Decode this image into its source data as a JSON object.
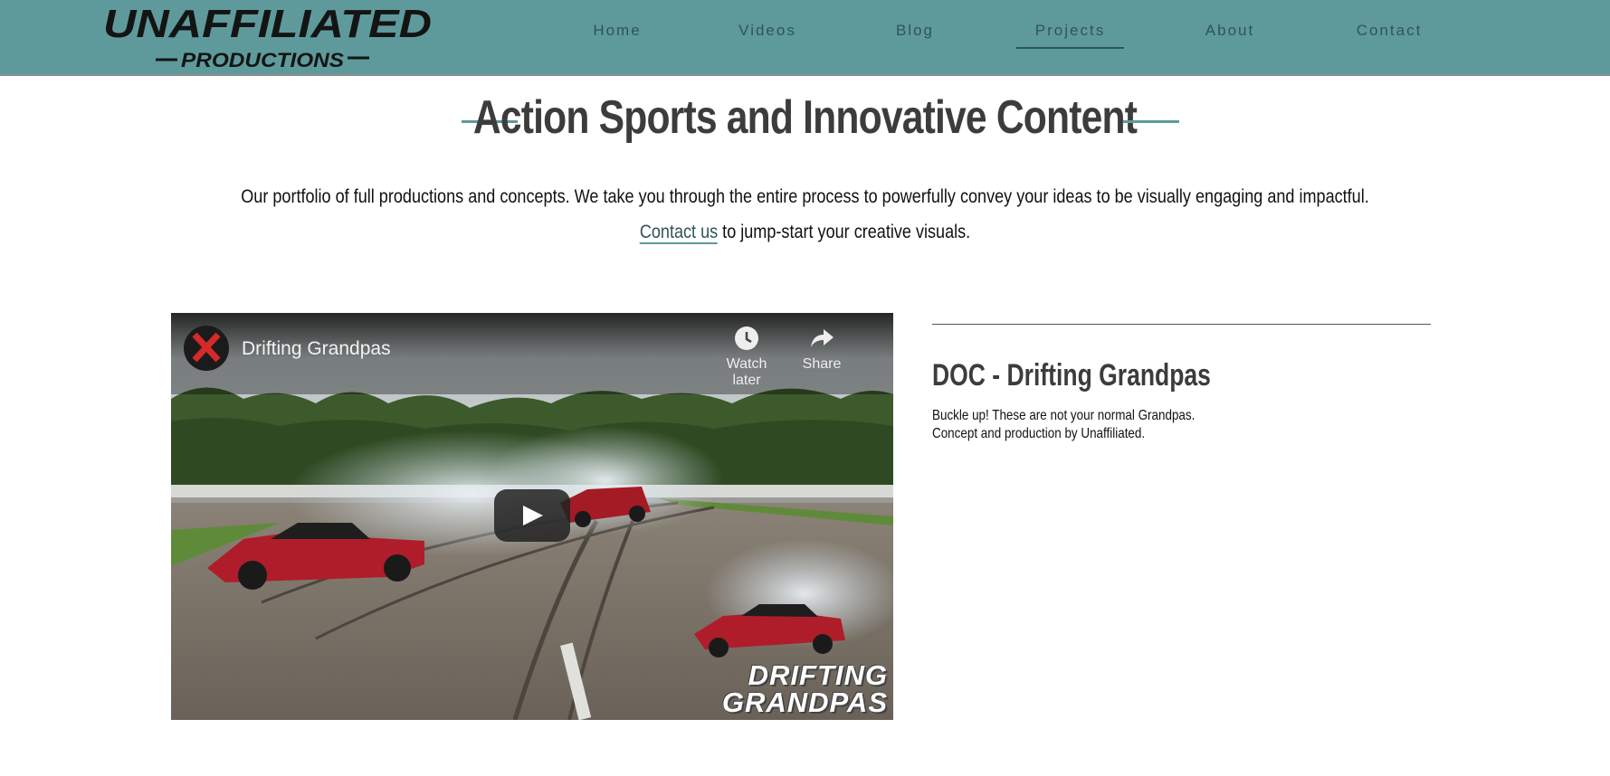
{
  "header": {
    "logo_top": "UNAFFILIATED",
    "logo_bottom": "PRODUCTIONS",
    "nav": [
      "Home",
      "Videos",
      "Blog",
      "Projects",
      "About",
      "Contact"
    ],
    "active_nav": "Projects"
  },
  "main": {
    "title": "Action Sports and Innovative Content",
    "intro_line1": "Our portfolio of full productions and concepts. We take you through the entire process to powerfully convey your ideas to be visually engaging and impactful.",
    "intro_link": "Contact us",
    "intro_line2_rest": " to jump-start your creative visuals."
  },
  "project": {
    "video": {
      "title": "Drifting Grandpas",
      "watch_later": "Watch later",
      "share": "Share",
      "overlay_line1": "DRIFTING",
      "overlay_line2": "GRANDPAS"
    },
    "title": "DOC - Drifting Grandpas",
    "desc_line1": "Buckle up! These are not your normal Grandpas.",
    "desc_line2": "Concept and production by Unaffiliated."
  },
  "colors": {
    "header_bg": "#5e9a9c",
    "nav_text": "#2f5556",
    "heading": "#3c3c3c"
  }
}
